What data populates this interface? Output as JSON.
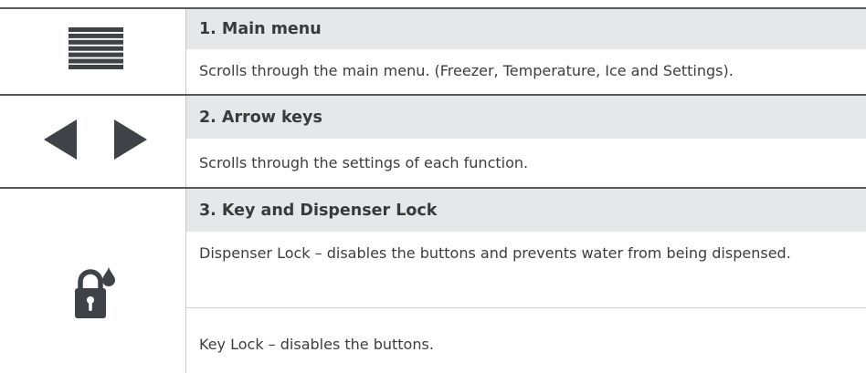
{
  "rows": [
    {
      "icon": "menu-lines-icon",
      "title": "1. Main menu",
      "descriptions": [
        "Scrolls through the main menu. (Freezer, Temperature, Ice and Settings)."
      ]
    },
    {
      "icon": "arrow-left-right-icons",
      "title": "2. Arrow keys",
      "descriptions": [
        "Scrolls through the settings of each function."
      ]
    },
    {
      "icon": "lock-droplet-icon",
      "title": "3. Key and Dispenser Lock",
      "descriptions": [
        "Dispenser Lock – disables the buttons and prevents water from being dispensed.",
        "Key Lock – disables the buttons."
      ]
    }
  ],
  "colors": {
    "heading_bg": "#e6e7e8",
    "rule_dark": "#55595c",
    "icon": "#3f4347"
  }
}
